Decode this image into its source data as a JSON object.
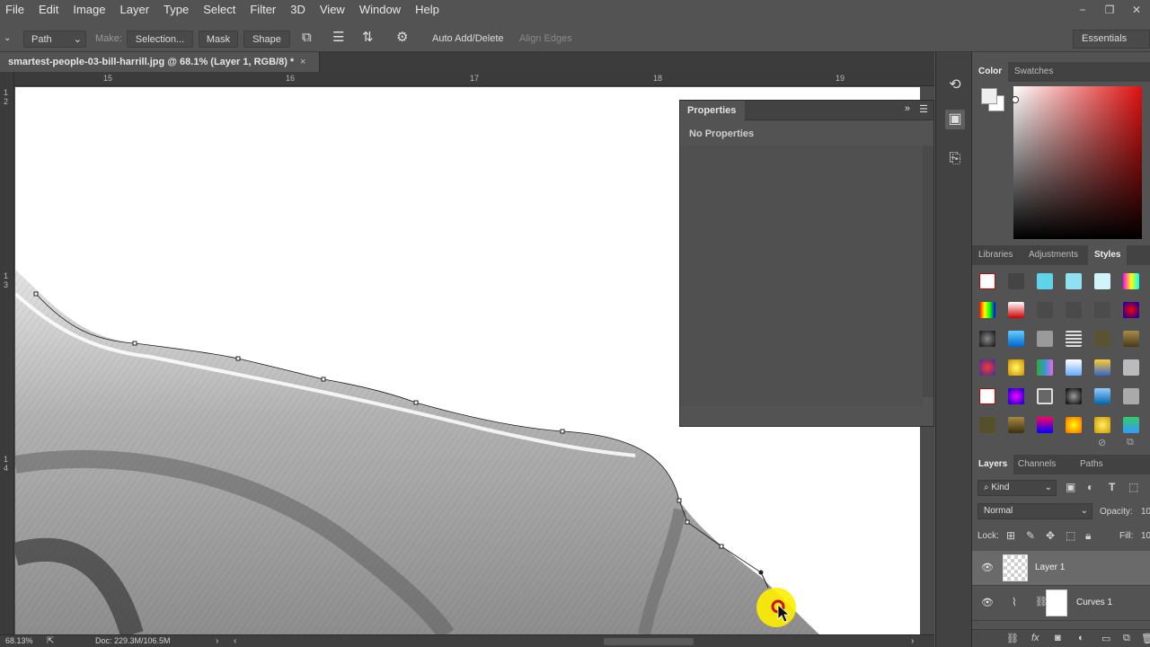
{
  "menu": [
    "File",
    "Edit",
    "Image",
    "Layer",
    "Type",
    "Select",
    "Filter",
    "3D",
    "View",
    "Window",
    "Help"
  ],
  "window_controls": [
    "−",
    "❐",
    "✕"
  ],
  "options_bar": {
    "mode": "Path",
    "make_label": "Make:",
    "selection": "Selection...",
    "mask": "Mask",
    "shape": "Shape",
    "auto_add_delete": "Auto Add/Delete",
    "align_edges": "Align Edges",
    "workspace": "Essentials"
  },
  "document": {
    "tab_title": "smartest-people-03-bill-harrill.jpg @ 68.1% (Layer 1, RGB/8) *",
    "close": "×"
  },
  "ruler": {
    "h": [
      "15",
      "16",
      "17",
      "18",
      "19"
    ],
    "v": [
      "1",
      "2",
      "1",
      "3",
      "1",
      "4"
    ]
  },
  "properties": {
    "title": "Properties",
    "content": "No Properties"
  },
  "status": {
    "zoom": "68.13%",
    "doc": "Doc: 229.3M/106.5M"
  },
  "color_panel": {
    "tabs": [
      "Color",
      "Swatches"
    ],
    "fg": "#eeeeee",
    "bg": "#ffffff",
    "hue": "#e01010"
  },
  "styles_panel": {
    "tabs": [
      "Libraries",
      "Adjustments",
      "Styles"
    ]
  },
  "layers_panel": {
    "tabs": [
      "Layers",
      "Channels",
      "Paths"
    ],
    "filter_kind": "Kind",
    "blend_mode": "Normal",
    "opacity_label": "Opacity:",
    "opacity_value": "10",
    "lock_label": "Lock:",
    "fill_label": "Fill:",
    "fill_value": "10",
    "layers": [
      {
        "name": "Layer 1",
        "selected": true
      },
      {
        "name": "Curves 1",
        "selected": false
      }
    ],
    "footer_icons": [
      "link-icon",
      "fx-icon",
      "mask-icon",
      "adjustment-icon",
      "group-icon",
      "new-layer-icon",
      "trash-icon"
    ]
  }
}
